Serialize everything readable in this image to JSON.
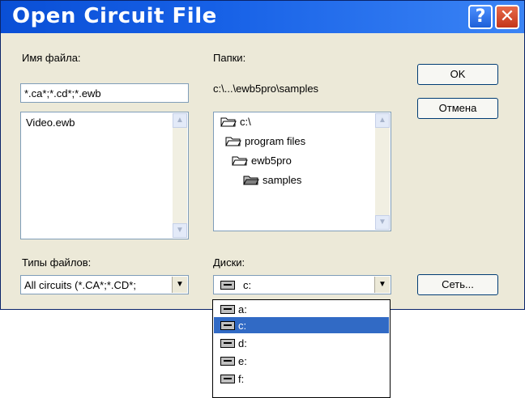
{
  "window": {
    "title": "Open Circuit File",
    "help_glyph": "?",
    "close_glyph": "✕",
    "accent": "#0a4fd6"
  },
  "filename": {
    "label": "Имя файла:",
    "value": "*.ca*;*.cd*;*.ewb",
    "files": [
      "Video.ewb"
    ]
  },
  "folders": {
    "label": "Папки:",
    "path": "c:\\...\\ewb5pro\\samples",
    "items": [
      "c:\\",
      "program files",
      "ewb5pro",
      "samples"
    ]
  },
  "buttons": {
    "ok": "OK",
    "cancel": "Отмена",
    "network": "Сеть..."
  },
  "filetypes": {
    "label": "Типы файлов:",
    "value": "All circuits (*.CA*;*.CD*;"
  },
  "drives": {
    "label": "Диски:",
    "value": "c:",
    "options": [
      "a:",
      "c:",
      "d:",
      "e:",
      "f:"
    ],
    "selected": "c:"
  }
}
